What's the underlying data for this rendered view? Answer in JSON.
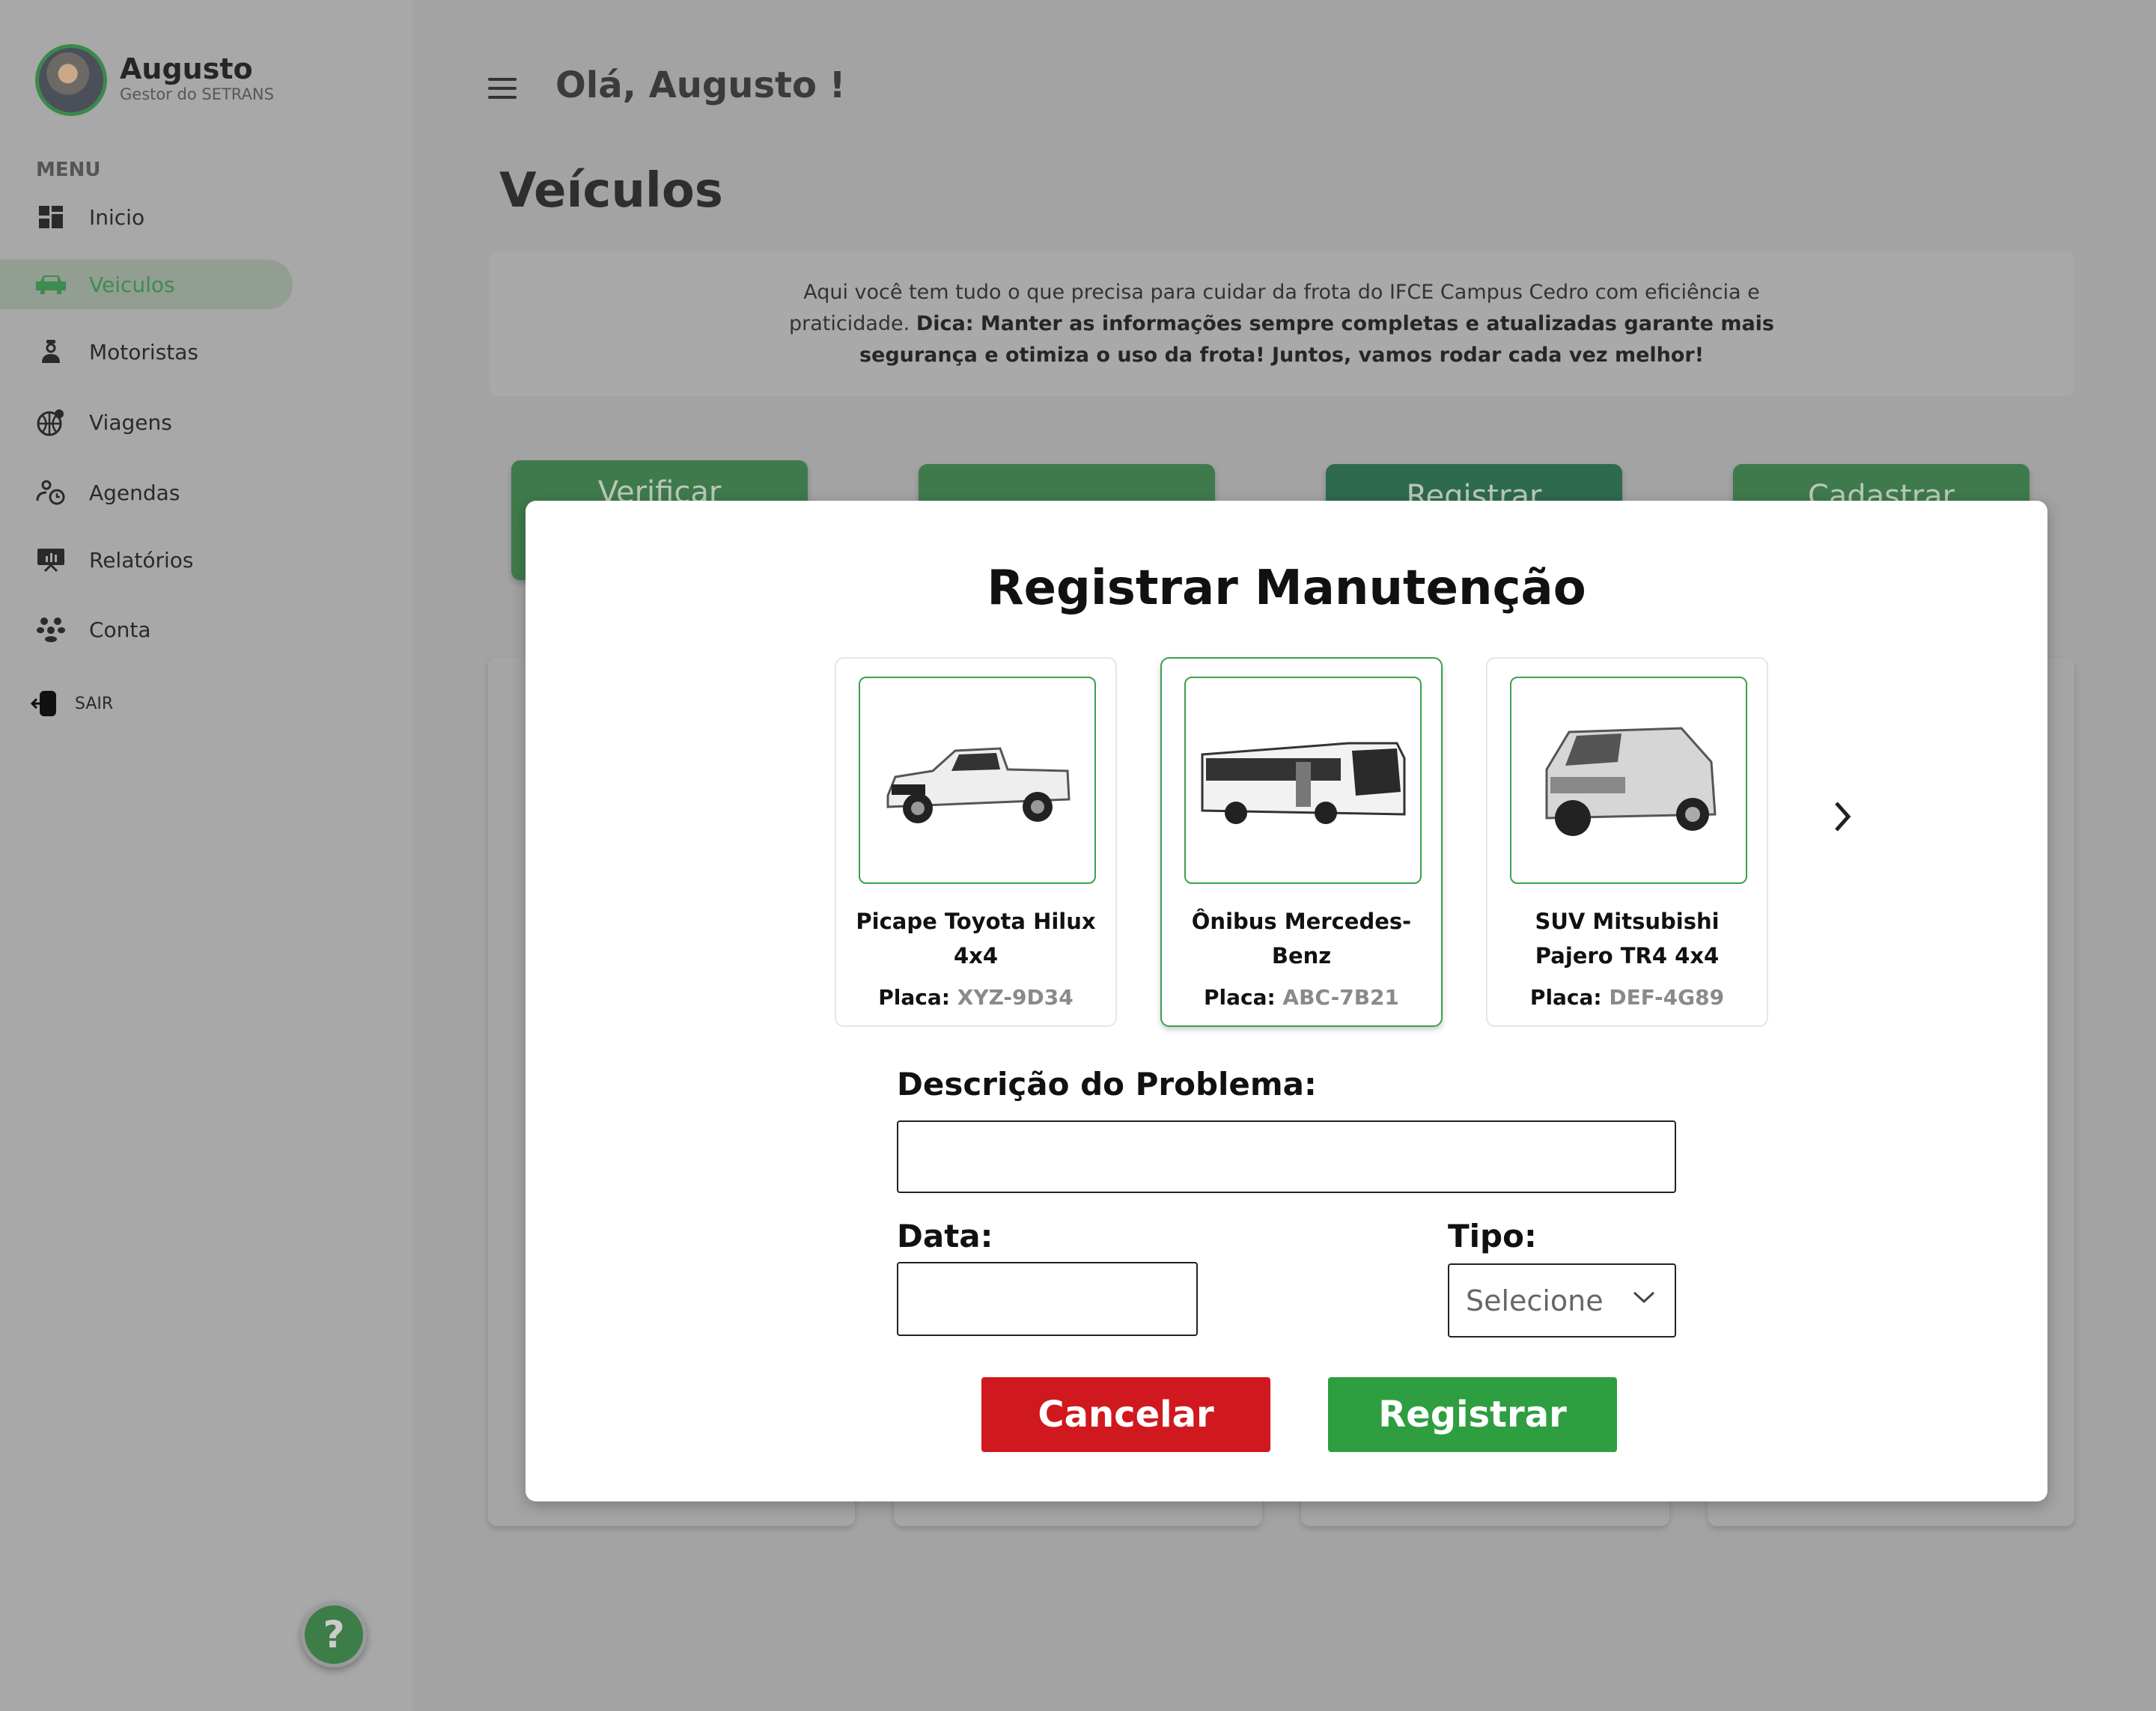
{
  "user": {
    "name": "Augusto",
    "role": "Gestor do SETRANS"
  },
  "sidebar": {
    "menu_heading": "MENU",
    "items": [
      {
        "label": "Inicio",
        "icon": "dashboard-icon"
      },
      {
        "label": "Veiculos",
        "icon": "car-icon",
        "active": true
      },
      {
        "label": "Motoristas",
        "icon": "driver-icon"
      },
      {
        "label": "Viagens",
        "icon": "globe-pin-icon"
      },
      {
        "label": "Agendas",
        "icon": "user-clock-icon"
      },
      {
        "label": "Relatórios",
        "icon": "chart-board-icon"
      },
      {
        "label": "Conta",
        "icon": "group-icon"
      }
    ],
    "logout": "SAIR",
    "help": "?"
  },
  "header": {
    "greeting": "Olá, Augusto !"
  },
  "page": {
    "title": "Veículos",
    "info_text": "Aqui você tem tudo o que precisa para cuidar da frota do IFCE Campus Cedro com eficiência e praticidade.",
    "info_bold": "Dica: Manter as informações sempre completas e atualizadas garante mais segurança e otimiza o uso da frota! Juntos, vamos rodar cada vez melhor!",
    "actions": [
      "Verificar",
      "",
      "Registrar",
      "Cadastrar"
    ]
  },
  "modal": {
    "title": "Registrar Manutenção",
    "vehicles": [
      {
        "name": "Picape Toyota Hilux 4x4",
        "plate_label": "Placa:",
        "plate": "XYZ-9D34",
        "selected": false
      },
      {
        "name": "Ônibus Mercedes-Benz",
        "plate_label": "Placa:",
        "plate": "ABC-7B21",
        "selected": true
      },
      {
        "name": "SUV Mitsubishi Pajero TR4 4x4",
        "plate_label": "Placa:",
        "plate": "DEF-4G89",
        "selected": false
      }
    ],
    "description_label": "Descrição do Problema:",
    "description_value": "",
    "date_label": "Data:",
    "date_value": "",
    "type_label": "Tipo:",
    "type_selected": "Selecione",
    "cancel": "Cancelar",
    "submit": "Registrar"
  },
  "colors": {
    "green": "#2e9e40",
    "red": "#d0191f",
    "accent": "#3aa14c"
  }
}
